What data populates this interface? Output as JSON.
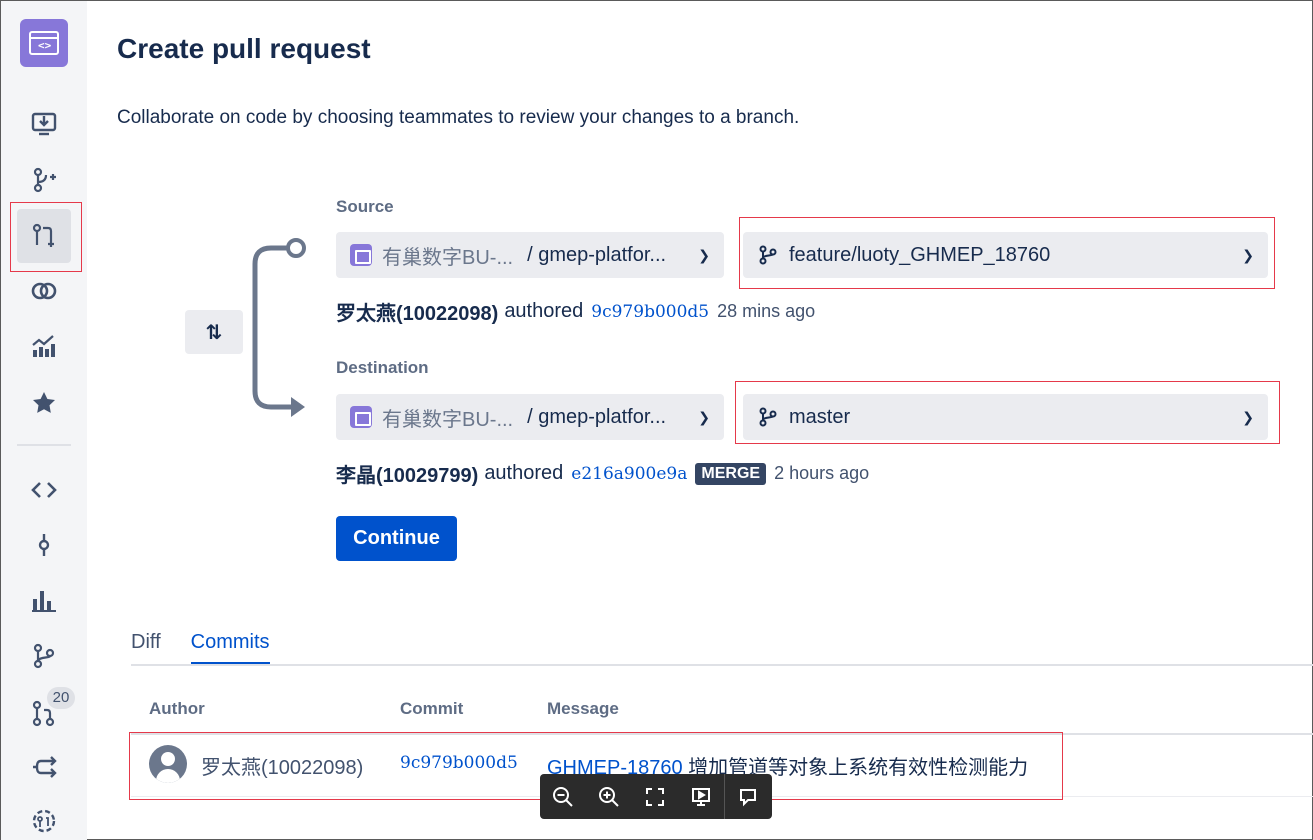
{
  "page": {
    "title": "Create pull request",
    "subtitle": "Collaborate on code by choosing teammates to review your changes to a branch."
  },
  "sidebar": {
    "pr_badge_count": "20"
  },
  "source": {
    "label": "Source",
    "project": "有巢数字BU-...",
    "repo": "/ gmep-platfor...",
    "branch": "feature/luoty_GHMEP_18760",
    "author": "罗太燕(10022098)",
    "authored_text": "authored",
    "commit_hash": "9c979b000d5",
    "time": "28 mins ago"
  },
  "destination": {
    "label": "Destination",
    "project": "有巢数字BU-...",
    "repo": "/ gmep-platfor...",
    "branch": "master",
    "author": "李晶(10029799)",
    "authored_text": "authored",
    "commit_hash": "e216a900e9a",
    "badge": "MERGE",
    "time": "2 hours ago"
  },
  "continue_label": "Continue",
  "tabs": [
    {
      "label": "Diff",
      "active": false
    },
    {
      "label": "Commits",
      "active": true
    }
  ],
  "commits_table": {
    "headers": [
      "Author",
      "Commit",
      "Message"
    ],
    "rows": [
      {
        "author": "罗太燕(10022098)",
        "commit": "9c979b000d5",
        "issue": "GHMEP-18760",
        "message": " 增加管道等对象上系统有效性检测能力"
      }
    ]
  },
  "colors": {
    "primary": "#0052cc",
    "logo": "#8777d9",
    "highlight_box": "#e5394a"
  }
}
